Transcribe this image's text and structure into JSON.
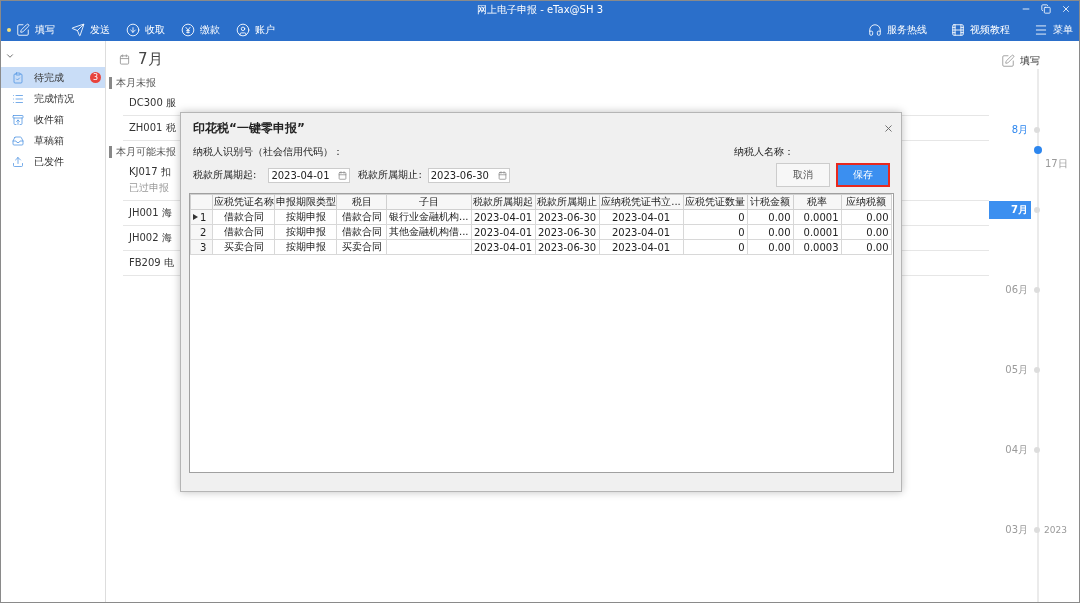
{
  "window": {
    "title": "网上电子申报 - eTax@SH 3"
  },
  "toolbar": {
    "items": [
      {
        "label": "填写",
        "selected": true
      },
      {
        "label": "发送",
        "selected": false
      },
      {
        "label": "收取",
        "selected": false
      },
      {
        "label": "缴款",
        "selected": false
      },
      {
        "label": "账户",
        "selected": false
      }
    ],
    "right_items": [
      {
        "label": "服务热线"
      },
      {
        "label": "视频教程"
      },
      {
        "label": "菜单"
      }
    ]
  },
  "sidebar": {
    "items": [
      {
        "label": "待完成",
        "selected": true,
        "badge": "3"
      },
      {
        "label": "完成情况",
        "selected": false
      },
      {
        "label": "收件箱",
        "selected": false
      },
      {
        "label": "草稿箱",
        "selected": false
      },
      {
        "label": "已发件",
        "selected": false
      }
    ]
  },
  "main": {
    "month_title": "7月",
    "write_link": "填写",
    "sections": [
      {
        "title": "本月未报",
        "items": [
          {
            "text": "DC300 服"
          },
          {
            "text": "ZH001 税"
          }
        ]
      },
      {
        "title": "本月可能未报",
        "items": [
          {
            "text": "KJ017 扣",
            "note": "已过申报"
          },
          {
            "text": "JH001 海"
          },
          {
            "text": "JH002 海"
          },
          {
            "text": "FB209 电"
          }
        ]
      }
    ]
  },
  "timeline": [
    {
      "kind": "month",
      "label": "8月",
      "selected": false,
      "active": true
    },
    {
      "kind": "today",
      "label": "17日"
    },
    {
      "kind": "month",
      "label": "7月",
      "selected": true,
      "active": true
    },
    {
      "kind": "month",
      "label": "06月",
      "selected": false,
      "active": false
    },
    {
      "kind": "month",
      "label": "05月",
      "selected": false,
      "active": false
    },
    {
      "kind": "month",
      "label": "04月",
      "selected": false,
      "active": false
    },
    {
      "kind": "month",
      "label": "03月",
      "selected": false,
      "active": false,
      "year": "2023"
    }
  ],
  "dialog": {
    "title": "印花税“一键零申报”",
    "taxpayer_id_label": "纳税人识别号（社会信用代码）：",
    "taxpayer_name_label": "纳税人名称：",
    "period_start": {
      "label": "税款所属期起:",
      "value": "2023-04-01"
    },
    "period_end": {
      "label": "税款所属期止:",
      "value": "2023-06-30"
    },
    "buttons": [
      {
        "label": "取消",
        "kind": "secondary"
      },
      {
        "label": "保存",
        "kind": "primary"
      }
    ],
    "table": {
      "columns": [
        "应税凭证名称",
        "申报期限类型",
        "税目",
        "子目",
        "税款所属期起",
        "税款所属期止",
        "应纳税凭证书立...",
        "应税凭证数量",
        "计税金额",
        "税率",
        "应纳税额"
      ],
      "rows": [
        {
          "index": "1",
          "current": true,
          "cells": [
            "借款合同",
            "按期申报",
            "借款合同",
            "银行业金融机构...",
            "2023-04-01",
            "2023-06-30",
            "2023-04-01",
            "0",
            "0.00",
            "0.0001",
            "0.00"
          ]
        },
        {
          "index": "2",
          "current": false,
          "cells": [
            "借款合同",
            "按期申报",
            "借款合同",
            "其他金融机构借...",
            "2023-04-01",
            "2023-06-30",
            "2023-04-01",
            "0",
            "0.00",
            "0.0001",
            "0.00"
          ]
        },
        {
          "index": "3",
          "current": false,
          "cells": [
            "买卖合同",
            "按期申报",
            "买卖合同",
            "",
            "2023-04-01",
            "2023-06-30",
            "2023-04-01",
            "0",
            "0.00",
            "0.0003",
            "0.00"
          ]
        }
      ]
    }
  }
}
